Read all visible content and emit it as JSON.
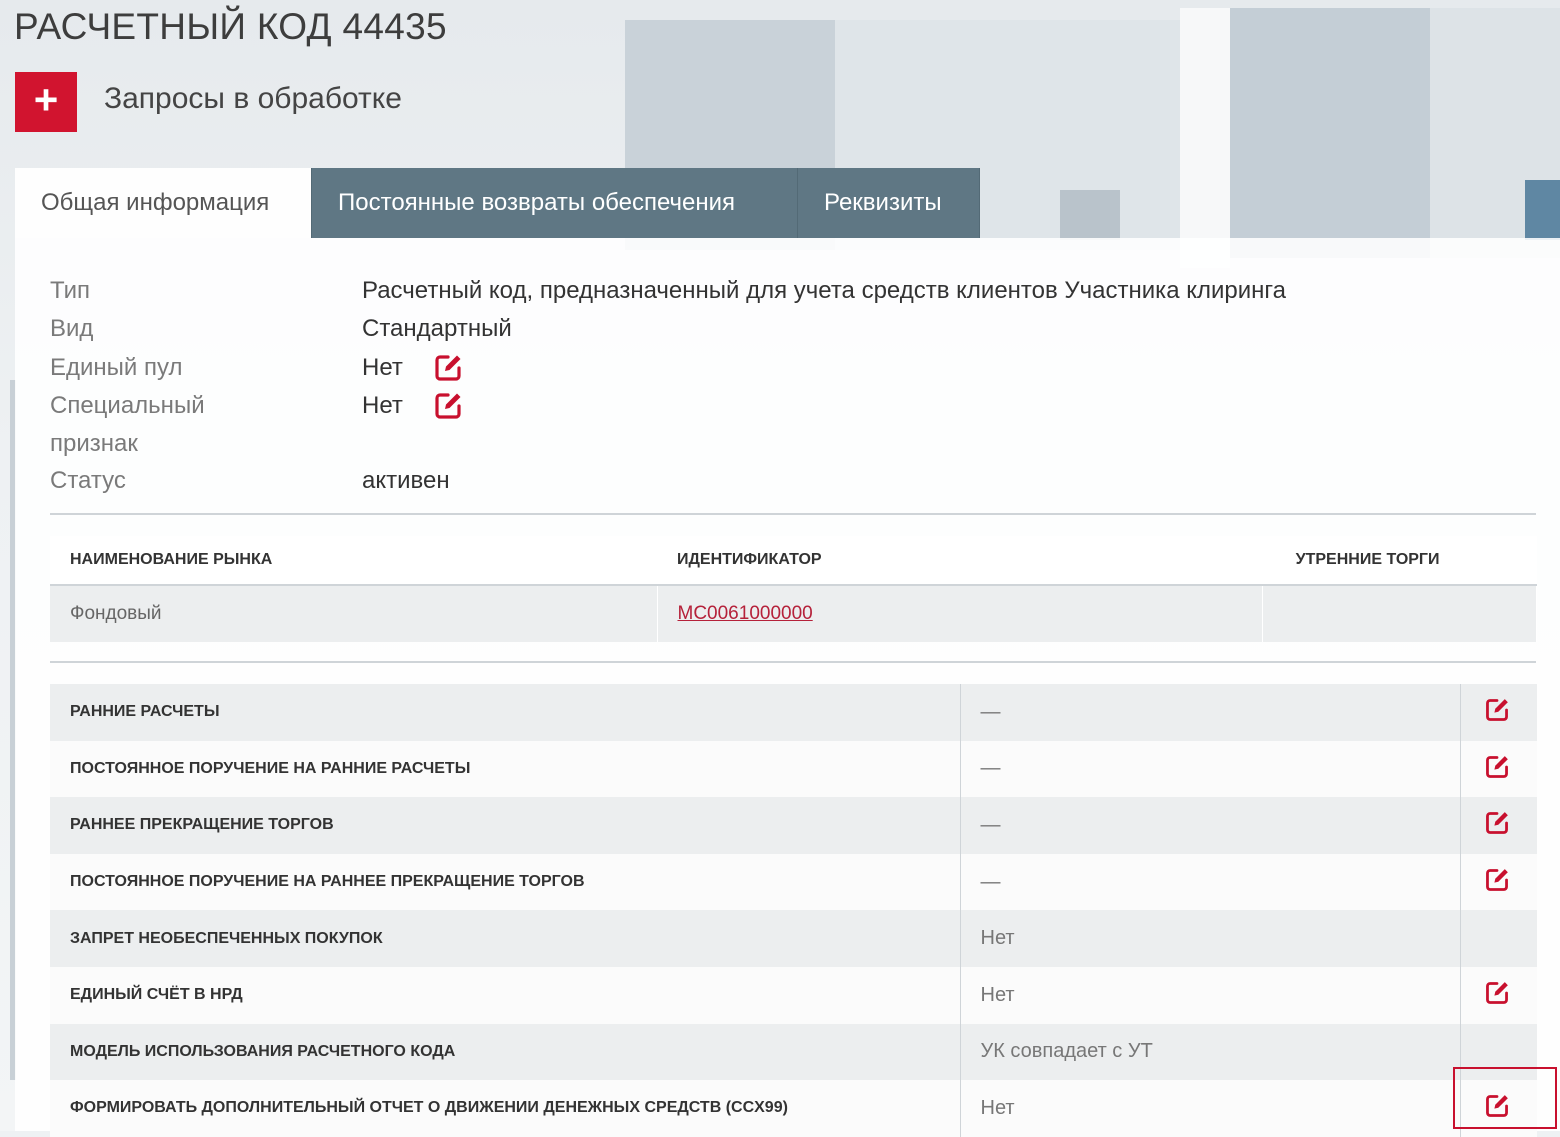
{
  "page": {
    "title": "РАСЧЕТНЫЙ КОД 44435"
  },
  "requests": {
    "add_symbol": "+",
    "label": "Запросы в обработке"
  },
  "tabs": [
    {
      "label": "Общая информация",
      "active": true
    },
    {
      "label": "Постоянные возвраты обеспечения",
      "active": false
    },
    {
      "label": "Реквизиты",
      "active": false
    }
  ],
  "info": {
    "type": {
      "label": "Тип",
      "value": "Расчетный код, предназначенный для учета средств клиентов Участника клиринга"
    },
    "kind": {
      "label": "Вид",
      "value": "Стандартный"
    },
    "single_pool": {
      "label": "Единый пул",
      "value": "Нет",
      "icon": "edit-icon"
    },
    "special": {
      "label_line1": "Специальный",
      "label_line2": "признак",
      "value": "Нет",
      "icon": "edit-icon"
    },
    "status": {
      "label": "Статус",
      "value": "активен"
    }
  },
  "market_table": {
    "headers": [
      "НАИМЕНОВАНИЕ РЫНКА",
      "ИДЕНТИФИКАТОР",
      "УТРЕННИЕ ТОРГИ"
    ],
    "rows": [
      {
        "market": "Фондовый",
        "identifier": "МС0061000000",
        "morning": ""
      }
    ]
  },
  "settings": [
    {
      "name": "РАННИЕ РАСЧЕТЫ",
      "value": "—",
      "editable": true
    },
    {
      "name": "ПОСТОЯННОЕ ПОРУЧЕНИЕ НА РАННИЕ РАСЧЕТЫ",
      "value": "—",
      "editable": true
    },
    {
      "name": "РАННЕЕ ПРЕКРАЩЕНИЕ ТОРГОВ",
      "value": "—",
      "editable": true
    },
    {
      "name": "ПОСТОЯННОЕ ПОРУЧЕНИЕ НА РАННЕЕ ПРЕКРАЩЕНИЕ ТОРГОВ",
      "value": "—",
      "editable": true
    },
    {
      "name": "ЗАПРЕТ НЕОБЕСПЕЧЕННЫХ ПОКУПОК",
      "value": "Нет",
      "editable": false
    },
    {
      "name": "ЕДИНЫЙ СЧЁТ В НРД",
      "value": "Нет",
      "editable": true
    },
    {
      "name": "МОДЕЛЬ ИСПОЛЬЗОВАНИЯ РАСЧЕТНОГО КОДА",
      "value": "УК совпадает с УТ",
      "editable": false
    },
    {
      "name": "ФОРМИРОВАТЬ ДОПОЛНИТЕЛЬНЫЙ ОТЧЕТ О ДВИЖЕНИИ ДЕНЕЖНЫХ СРЕДСТВ (CCX99)",
      "value": "Нет",
      "editable": true
    }
  ],
  "colors": {
    "accent": "#d1142f",
    "tab_inactive": "#5f7784",
    "link": "#b5213a",
    "highlight": "#c8102e"
  }
}
